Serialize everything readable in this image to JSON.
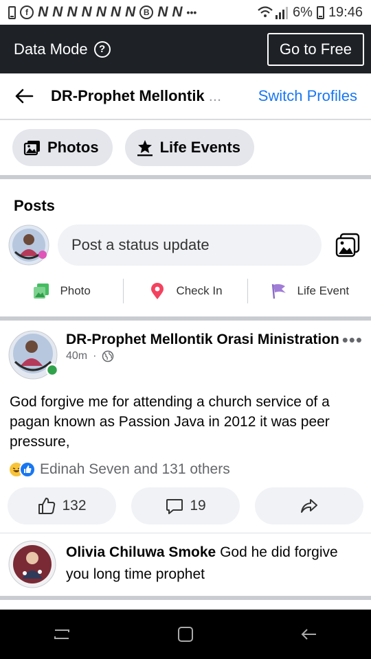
{
  "status_bar": {
    "n_glyphs": [
      "N",
      "N",
      "N",
      "N",
      "N",
      "N",
      "N",
      "N",
      "N"
    ],
    "dots": "•••",
    "battery": "6%",
    "time": "19:46"
  },
  "data_mode": {
    "label": "Data Mode",
    "go_free_label": "Go to Free"
  },
  "header": {
    "title": "DR-Prophet Mellontik",
    "ellipsis": "...",
    "switch_label": "Switch Profiles"
  },
  "chips": [
    {
      "label": "Photos",
      "icon": "photos-icon"
    },
    {
      "label": "Life Events",
      "icon": "star-flag-icon"
    }
  ],
  "composer": {
    "section_title": "Posts",
    "placeholder": "Post a status update",
    "actions": [
      {
        "label": "Photo",
        "icon": "photo-icon",
        "color": "#45bd62"
      },
      {
        "label": "Check In",
        "icon": "location-pin-icon",
        "color": "#f3425f"
      },
      {
        "label": "Life Event",
        "icon": "flag-icon",
        "color": "#a07dd6"
      }
    ]
  },
  "post": {
    "author": "DR-Prophet Mellontik Orasi Ministration",
    "time": "40m",
    "dot": "·",
    "text": "God forgive me for attending a church service of a pagan known as Passion Java in 2012 it was peer pressure,",
    "reactions_text": "Edinah Seven and 131 others",
    "like_count": "132",
    "comment_count": "19"
  },
  "comment": {
    "author": "Olivia Chiluwa Smoke",
    "text": "God he did forgive  you long time  prophet"
  },
  "colors": {
    "accent": "#1877f2",
    "data_mode_bg": "#1e2227",
    "online": "#31a24c"
  }
}
